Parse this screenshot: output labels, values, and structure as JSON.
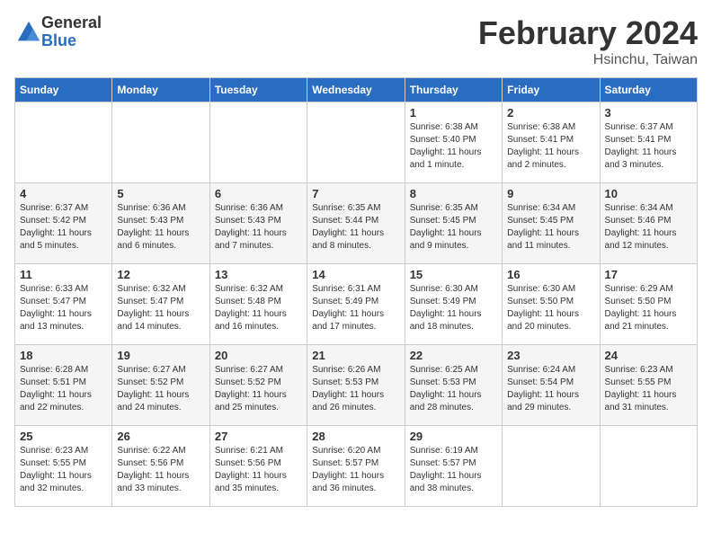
{
  "logo": {
    "general": "General",
    "blue": "Blue"
  },
  "header": {
    "month": "February 2024",
    "location": "Hsinchu, Taiwan"
  },
  "days_of_week": [
    "Sunday",
    "Monday",
    "Tuesday",
    "Wednesday",
    "Thursday",
    "Friday",
    "Saturday"
  ],
  "weeks": [
    [
      {
        "day": "",
        "info": ""
      },
      {
        "day": "",
        "info": ""
      },
      {
        "day": "",
        "info": ""
      },
      {
        "day": "",
        "info": ""
      },
      {
        "day": "1",
        "info": "Sunrise: 6:38 AM\nSunset: 5:40 PM\nDaylight: 11 hours\nand 1 minute."
      },
      {
        "day": "2",
        "info": "Sunrise: 6:38 AM\nSunset: 5:41 PM\nDaylight: 11 hours\nand 2 minutes."
      },
      {
        "day": "3",
        "info": "Sunrise: 6:37 AM\nSunset: 5:41 PM\nDaylight: 11 hours\nand 3 minutes."
      }
    ],
    [
      {
        "day": "4",
        "info": "Sunrise: 6:37 AM\nSunset: 5:42 PM\nDaylight: 11 hours\nand 5 minutes."
      },
      {
        "day": "5",
        "info": "Sunrise: 6:36 AM\nSunset: 5:43 PM\nDaylight: 11 hours\nand 6 minutes."
      },
      {
        "day": "6",
        "info": "Sunrise: 6:36 AM\nSunset: 5:43 PM\nDaylight: 11 hours\nand 7 minutes."
      },
      {
        "day": "7",
        "info": "Sunrise: 6:35 AM\nSunset: 5:44 PM\nDaylight: 11 hours\nand 8 minutes."
      },
      {
        "day": "8",
        "info": "Sunrise: 6:35 AM\nSunset: 5:45 PM\nDaylight: 11 hours\nand 9 minutes."
      },
      {
        "day": "9",
        "info": "Sunrise: 6:34 AM\nSunset: 5:45 PM\nDaylight: 11 hours\nand 11 minutes."
      },
      {
        "day": "10",
        "info": "Sunrise: 6:34 AM\nSunset: 5:46 PM\nDaylight: 11 hours\nand 12 minutes."
      }
    ],
    [
      {
        "day": "11",
        "info": "Sunrise: 6:33 AM\nSunset: 5:47 PM\nDaylight: 11 hours\nand 13 minutes."
      },
      {
        "day": "12",
        "info": "Sunrise: 6:32 AM\nSunset: 5:47 PM\nDaylight: 11 hours\nand 14 minutes."
      },
      {
        "day": "13",
        "info": "Sunrise: 6:32 AM\nSunset: 5:48 PM\nDaylight: 11 hours\nand 16 minutes."
      },
      {
        "day": "14",
        "info": "Sunrise: 6:31 AM\nSunset: 5:49 PM\nDaylight: 11 hours\nand 17 minutes."
      },
      {
        "day": "15",
        "info": "Sunrise: 6:30 AM\nSunset: 5:49 PM\nDaylight: 11 hours\nand 18 minutes."
      },
      {
        "day": "16",
        "info": "Sunrise: 6:30 AM\nSunset: 5:50 PM\nDaylight: 11 hours\nand 20 minutes."
      },
      {
        "day": "17",
        "info": "Sunrise: 6:29 AM\nSunset: 5:50 PM\nDaylight: 11 hours\nand 21 minutes."
      }
    ],
    [
      {
        "day": "18",
        "info": "Sunrise: 6:28 AM\nSunset: 5:51 PM\nDaylight: 11 hours\nand 22 minutes."
      },
      {
        "day": "19",
        "info": "Sunrise: 6:27 AM\nSunset: 5:52 PM\nDaylight: 11 hours\nand 24 minutes."
      },
      {
        "day": "20",
        "info": "Sunrise: 6:27 AM\nSunset: 5:52 PM\nDaylight: 11 hours\nand 25 minutes."
      },
      {
        "day": "21",
        "info": "Sunrise: 6:26 AM\nSunset: 5:53 PM\nDaylight: 11 hours\nand 26 minutes."
      },
      {
        "day": "22",
        "info": "Sunrise: 6:25 AM\nSunset: 5:53 PM\nDaylight: 11 hours\nand 28 minutes."
      },
      {
        "day": "23",
        "info": "Sunrise: 6:24 AM\nSunset: 5:54 PM\nDaylight: 11 hours\nand 29 minutes."
      },
      {
        "day": "24",
        "info": "Sunrise: 6:23 AM\nSunset: 5:55 PM\nDaylight: 11 hours\nand 31 minutes."
      }
    ],
    [
      {
        "day": "25",
        "info": "Sunrise: 6:23 AM\nSunset: 5:55 PM\nDaylight: 11 hours\nand 32 minutes."
      },
      {
        "day": "26",
        "info": "Sunrise: 6:22 AM\nSunset: 5:56 PM\nDaylight: 11 hours\nand 33 minutes."
      },
      {
        "day": "27",
        "info": "Sunrise: 6:21 AM\nSunset: 5:56 PM\nDaylight: 11 hours\nand 35 minutes."
      },
      {
        "day": "28",
        "info": "Sunrise: 6:20 AM\nSunset: 5:57 PM\nDaylight: 11 hours\nand 36 minutes."
      },
      {
        "day": "29",
        "info": "Sunrise: 6:19 AM\nSunset: 5:57 PM\nDaylight: 11 hours\nand 38 minutes."
      },
      {
        "day": "",
        "info": ""
      },
      {
        "day": "",
        "info": ""
      }
    ]
  ]
}
